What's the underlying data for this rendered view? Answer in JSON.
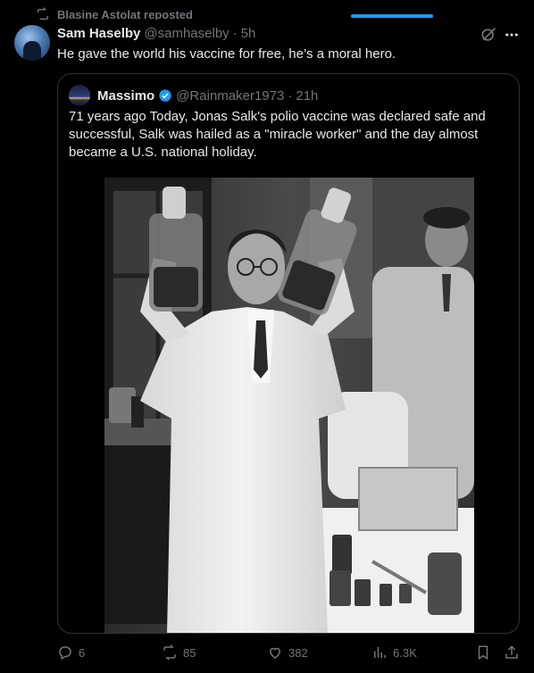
{
  "context": {
    "repost_text": "Blasine Astolat reposted"
  },
  "post": {
    "author_name": "Sam Haselby",
    "handle": "@samhaselby",
    "separator": "·",
    "time": "5h",
    "text": "He gave the world his vaccine for free, he’s a moral hero."
  },
  "quote": {
    "author_name": "Massimo",
    "handle": "@Rainmaker1973",
    "separator": "·",
    "time": "21h",
    "text": "71 years ago Today, Jonas Salk's polio vaccine was declared safe and successful, Salk was hailed as a \"miracle worker\" and the day almost became a U.S. national holiday."
  },
  "actions": {
    "replies": "6",
    "reposts": "85",
    "likes": "382",
    "views": "6.3K"
  },
  "icons": [
    "repost-icon",
    "grok-icon",
    "more-icon",
    "verified-badge-icon",
    "reply-icon",
    "like-icon",
    "views-icon",
    "bookmark-icon",
    "share-icon"
  ],
  "colors": {
    "background": "#000000",
    "text": "#e7e9ea",
    "muted": "#71767b",
    "accent": "#1d9bf0",
    "border": "#2f3336"
  }
}
